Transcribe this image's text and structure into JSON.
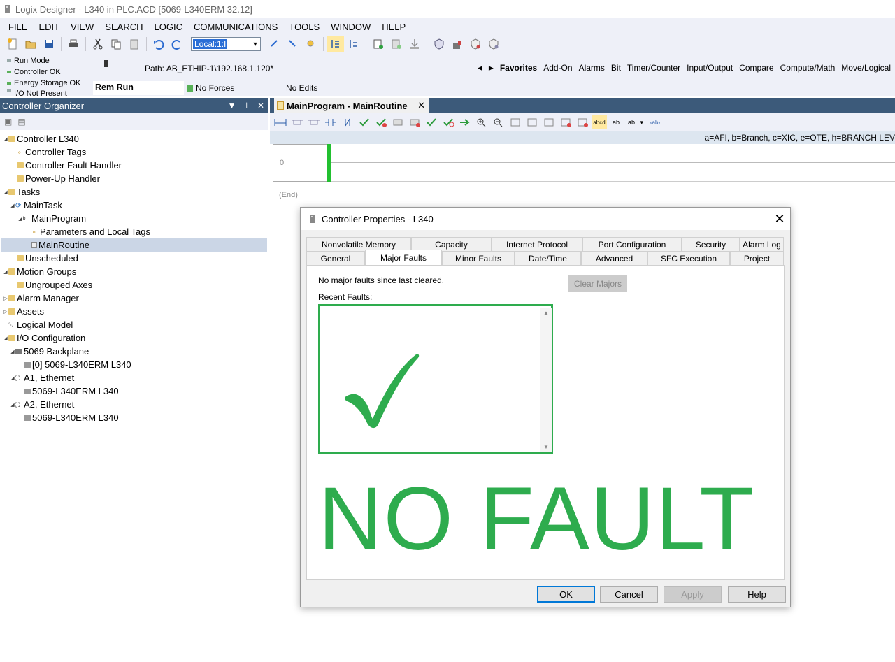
{
  "window": {
    "title": "Logix Designer - L340 in PLC.ACD [5069-L340ERM 32.12]"
  },
  "menu": [
    "FILE",
    "EDIT",
    "VIEW",
    "SEARCH",
    "LOGIC",
    "COMMUNICATIONS",
    "TOOLS",
    "WINDOW",
    "HELP"
  ],
  "toolbar": {
    "path_value": "Local:1:I"
  },
  "status": {
    "lines": [
      "Run Mode",
      "Controller OK",
      "Energy Storage OK",
      "I/O Not Present"
    ],
    "mode": "Rem Run",
    "forces": "No Forces",
    "edits": "No Edits",
    "path": "Path:  AB_ETHIP-1\\192.168.1.120*"
  },
  "instruction_tabs": [
    "Favorites",
    "Add-On",
    "Alarms",
    "Bit",
    "Timer/Counter",
    "Input/Output",
    "Compare",
    "Compute/Math",
    "Move/Logical"
  ],
  "organizer": {
    "title": "Controller Organizer",
    "nodes": [
      {
        "label": "Controller L340"
      },
      {
        "label": "Controller Tags"
      },
      {
        "label": "Controller Fault Handler"
      },
      {
        "label": "Power-Up Handler"
      },
      {
        "label": "Tasks"
      },
      {
        "label": "MainTask"
      },
      {
        "label": "MainProgram"
      },
      {
        "label": "Parameters and Local Tags"
      },
      {
        "label": "MainRoutine"
      },
      {
        "label": "Unscheduled"
      },
      {
        "label": "Motion Groups"
      },
      {
        "label": "Ungrouped Axes"
      },
      {
        "label": "Alarm Manager"
      },
      {
        "label": "Assets"
      },
      {
        "label": "Logical Model"
      },
      {
        "label": "I/O Configuration"
      },
      {
        "label": "5069 Backplane"
      },
      {
        "label": "[0] 5069-L340ERM L340"
      },
      {
        "label": "A1, Ethernet"
      },
      {
        "label": "5069-L340ERM L340"
      },
      {
        "label": "A2, Ethernet"
      },
      {
        "label": "5069-L340ERM L340"
      }
    ]
  },
  "editor": {
    "tab": "MainProgram - MainRoutine",
    "mnemonics": "a=AFI, b=Branch, c=XIC, e=OTE, h=BRANCH LEV",
    "rung": "0",
    "end": "(End)"
  },
  "dialog": {
    "title": "Controller Properties - L340",
    "tabs_row1": [
      "Nonvolatile Memory",
      "Capacity",
      "Internet Protocol",
      "Port Configuration",
      "Security",
      "Alarm Log"
    ],
    "tabs_row2": [
      "General",
      "Major Faults",
      "Minor Faults",
      "Date/Time",
      "Advanced",
      "SFC Execution",
      "Project"
    ],
    "active_tab": "Major Faults",
    "no_faults_text": "No major faults since last cleared.",
    "recent_label": "Recent Faults:",
    "clear_button": "Clear Majors",
    "overlay_text": "NO FAULT",
    "buttons": {
      "ok": "OK",
      "cancel": "Cancel",
      "apply": "Apply",
      "help": "Help"
    }
  },
  "colors": {
    "accent_green": "#2eac4e",
    "panel_header": "#3c5a7a"
  }
}
